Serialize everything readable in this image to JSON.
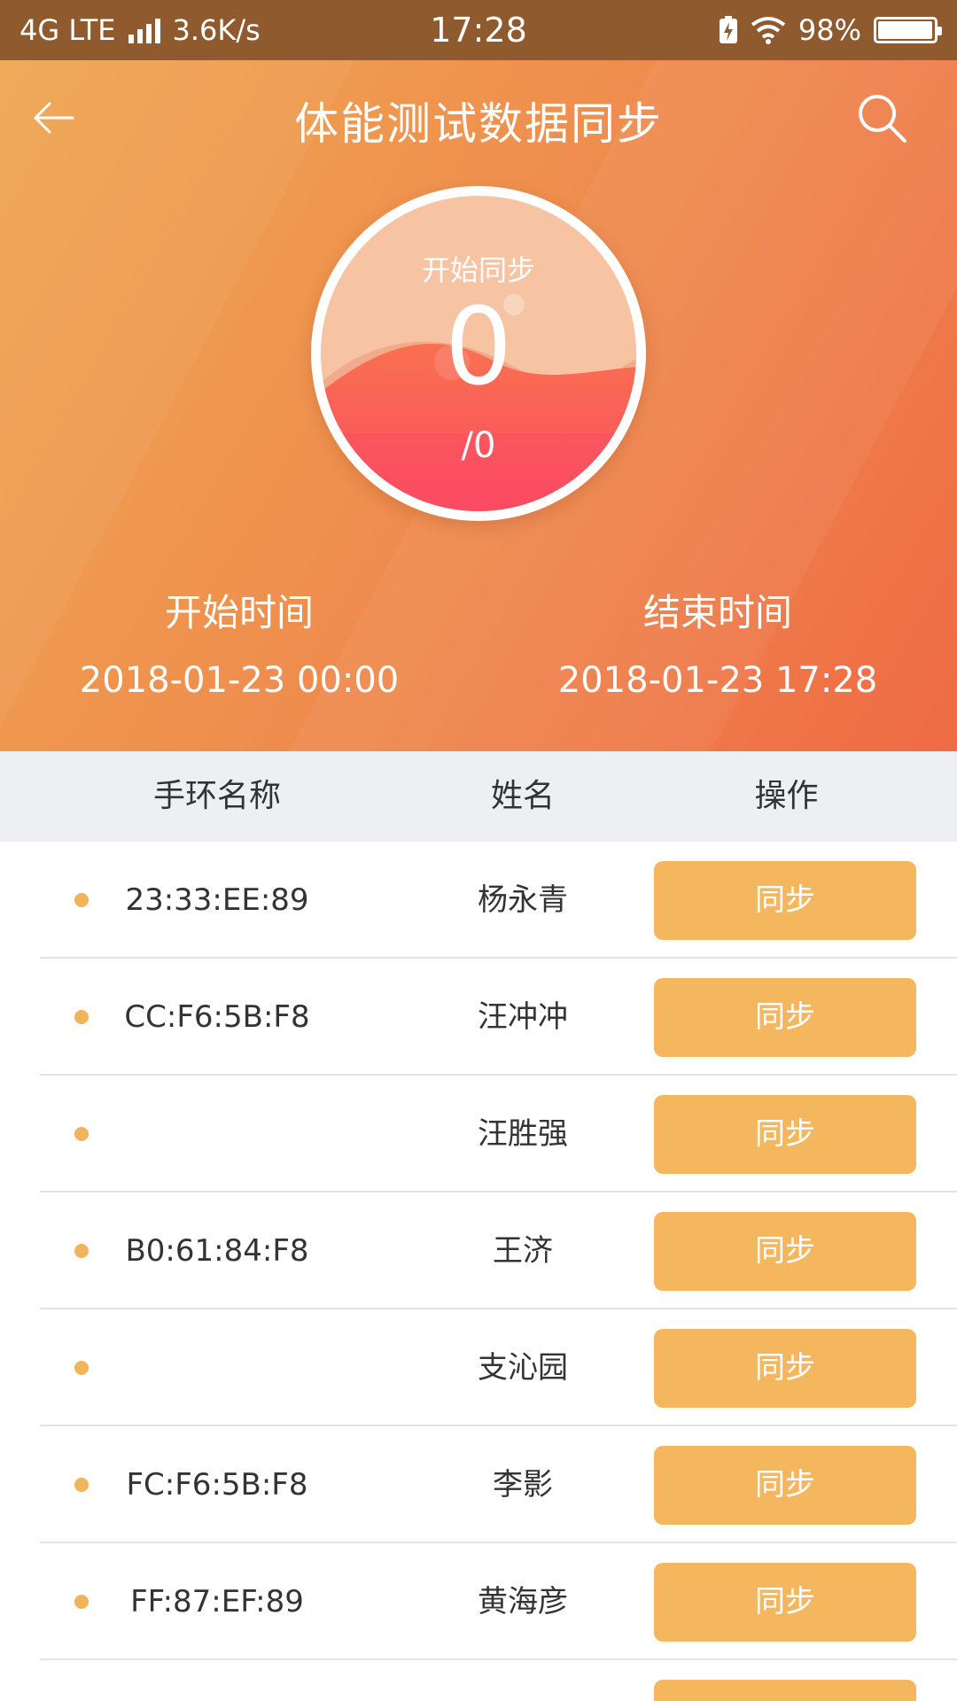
{
  "status_bar": {
    "network": "4G LTE",
    "speed": "3.6K/s",
    "time": "17:28",
    "battery": "98%",
    "battery_level": 0.98
  },
  "header": {
    "title": "体能测试数据同步",
    "back_icon": "back-arrow-icon",
    "search_icon": "search-icon"
  },
  "gauge": {
    "label": "开始同步",
    "value": "0",
    "total": "/0"
  },
  "time_range": {
    "start_label": "开始时间",
    "start_value": "2018-01-23 00:00",
    "end_label": "结束时间",
    "end_value": "2018-01-23 17:28"
  },
  "table": {
    "headers": [
      "手环名称",
      "姓名",
      "操作"
    ],
    "rows": [
      {
        "device": "23:33:EE:89",
        "name": "杨永青",
        "action": "同步"
      },
      {
        "device": "CC:F6:5B:F8",
        "name": "汪冲冲",
        "action": "同步"
      },
      {
        "device": "",
        "name": "汪胜强",
        "action": "同步"
      },
      {
        "device": "B0:61:84:F8",
        "name": "王济",
        "action": "同步"
      },
      {
        "device": "",
        "name": "支沁园",
        "action": "同步"
      },
      {
        "device": "FC:F6:5B:F8",
        "name": "李影",
        "action": "同步"
      },
      {
        "device": "FF:87:EF:89",
        "name": "黄海彦",
        "action": "同步"
      },
      {
        "device": "",
        "name": "",
        "action": ""
      }
    ]
  },
  "colors": {
    "status_bar": "#8e5a2e",
    "gradient_start": "#efa652",
    "gradient_end": "#ef6b45",
    "accent": "#f4b75e",
    "header_bg": "#eeeff2"
  }
}
